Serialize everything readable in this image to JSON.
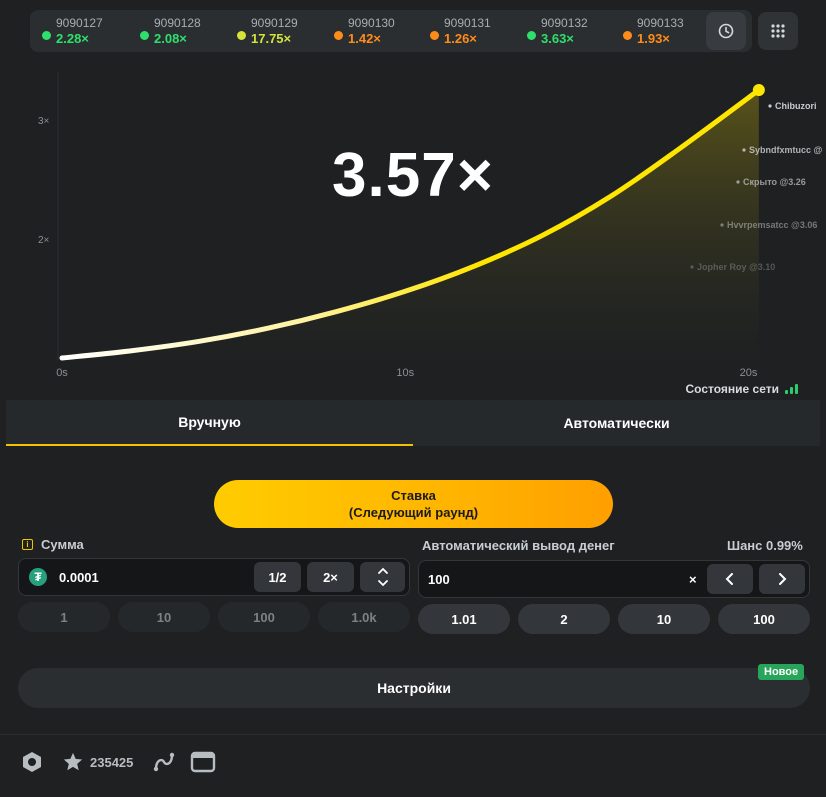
{
  "history": [
    {
      "id": "9090127",
      "mult": "2.28×",
      "color": "#2ee06b"
    },
    {
      "id": "9090128",
      "mult": "2.08×",
      "color": "#2ee06b"
    },
    {
      "id": "9090129",
      "mult": "17.75×",
      "color": "#d4e33a"
    },
    {
      "id": "9090130",
      "mult": "1.42×",
      "color": "#ff8c1a"
    },
    {
      "id": "9090131",
      "mult": "1.26×",
      "color": "#ff8c1a"
    },
    {
      "id": "9090132",
      "mult": "3.63×",
      "color": "#2ee06b"
    },
    {
      "id": "9090133",
      "mult": "1.93×",
      "color": "#ff8c1a"
    }
  ],
  "icons": {
    "history": "clock-icon",
    "grid": "grid-dots-icon"
  },
  "chart": {
    "current_multiplier": "3.57×"
  },
  "chart_data": {
    "type": "line",
    "title": "",
    "xlabel": "",
    "ylabel": "",
    "x_ticks": [
      "0s",
      "10s",
      "20s"
    ],
    "y_ticks": [
      "2×",
      "3×"
    ],
    "xlim": [
      0,
      20.8
    ],
    "ylim": [
      1,
      3.25
    ],
    "series": [
      {
        "x": [
          0,
          2,
          4,
          6,
          8,
          10,
          12,
          14,
          16,
          18,
          20.3
        ],
        "y": [
          1.0,
          1.06,
          1.14,
          1.25,
          1.39,
          1.56,
          1.77,
          2.03,
          2.36,
          2.76,
          3.25
        ]
      }
    ],
    "cashouts": [
      {
        "label": "Chibuzori"
      },
      {
        "label": "Sybndfxmtucc @"
      },
      {
        "label": "Скрыто @3.26"
      },
      {
        "label": "Hvvrpemsatcc @3.06"
      },
      {
        "label": "Jopher Roy @3.10"
      }
    ],
    "line_color": "#ffe600"
  },
  "network": {
    "label": "Состояние сети"
  },
  "tabs": [
    {
      "label": "Вручную"
    },
    {
      "label": "Автоматически"
    }
  ],
  "bet_button": {
    "line1": "Ставка",
    "line2": "(Следующий раунд)"
  },
  "amount": {
    "label": "Сумма",
    "value": "0.0001",
    "half": "1/2",
    "double": "2×",
    "quick": [
      "1",
      "10",
      "100",
      "1.0k"
    ]
  },
  "autocashout": {
    "label": "Автоматический вывод денег",
    "chance": "Шанс 0.99%",
    "value": "100",
    "suffix": "×",
    "quick": [
      "1.01",
      "2",
      "10",
      "100"
    ]
  },
  "settings": {
    "label": "Настройки",
    "badge": "Новое"
  },
  "footer": {
    "stars": "235425"
  }
}
